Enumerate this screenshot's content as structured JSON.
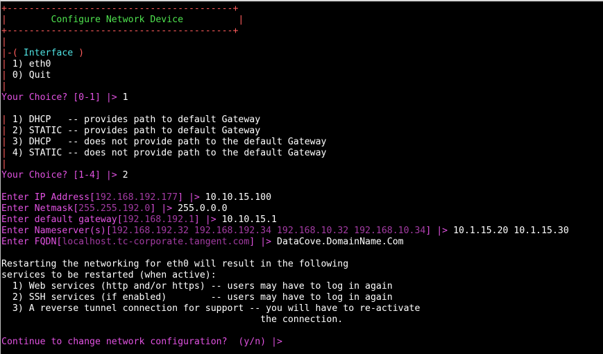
{
  "colors": {
    "background": "#000000",
    "border": "#ff5c5c",
    "title": "#4fe34f",
    "section": "#4fe3e3",
    "prompt": "#e152e1",
    "default_value": "#a33ba3",
    "text": "#ffffff"
  },
  "box": {
    "top_border": "+-----------------------------------------+",
    "title_row_left": "|",
    "title": "        Configure Network Device          ",
    "title_row_right": "|",
    "bottom_border": "+-----------------------------------------+"
  },
  "interface_menu": {
    "blank_bar": "|",
    "header_prefix": "|-(",
    "header_label": " Interface ",
    "header_suffix": ")",
    "options": [
      {
        "bar": "|",
        "text": " 1) eth0"
      },
      {
        "bar": "|",
        "text": " 0) Quit"
      }
    ],
    "trailing_bar": "|"
  },
  "choice1": {
    "prompt": "Your Choice? [0-1] |> ",
    "answer": "1"
  },
  "mode_menu": {
    "options": [
      {
        "bar": "|",
        "text": " 1) DHCP   -- provides path to default Gateway"
      },
      {
        "bar": "|",
        "text": " 2) STATIC -- provides path to default Gateway"
      },
      {
        "bar": "|",
        "text": " 3) DHCP   -- does not provide path to the default Gateway"
      },
      {
        "bar": "|",
        "text": " 4) STATIC -- does not provide path to the default Gateway"
      }
    ],
    "trailing_bar": "|"
  },
  "choice2": {
    "prompt": "Your Choice? [1-4] |> ",
    "answer": "2"
  },
  "fields": {
    "ip": {
      "label": "Enter IP Address[",
      "default": "192.168.192.177",
      "close": "] |> ",
      "value": "10.10.15.100"
    },
    "netmask": {
      "label": "Enter Netmask[",
      "default": "255.255.192.0",
      "close": "] |> ",
      "value": "255.0.0.0"
    },
    "gateway": {
      "label": "Enter default gateway[",
      "default": "192.168.192.1",
      "close": "] |> ",
      "value": "10.10.15.1"
    },
    "nameserver": {
      "label": "Enter Nameserver(s)[",
      "default": "192.168.192.32 192.168.192.34 192.168.10.32 192.168.10.34",
      "close": "] |> ",
      "value": "10.1.15.20 10.1.15.30"
    },
    "fqdn": {
      "label": "Enter FQDN[",
      "default": "localhost.tc-corporate.tangent.com",
      "close": "] |> ",
      "value": "DataCove.DomainName.Com"
    }
  },
  "warning": {
    "lines": [
      "Restarting the networking for eth0 will result in the following",
      "services to be restarted (when active):",
      "  1) Web services (http and/or https) -- users may have to log in again",
      "  2) SSH services (if enabled)        -- users may have to log in again",
      "  3) A reverse tunnel connection for support -- you will have to re-activate",
      "                                               the connection."
    ]
  },
  "confirm": {
    "prompt": "Continue to change network configuration?  (y/n) |> "
  }
}
